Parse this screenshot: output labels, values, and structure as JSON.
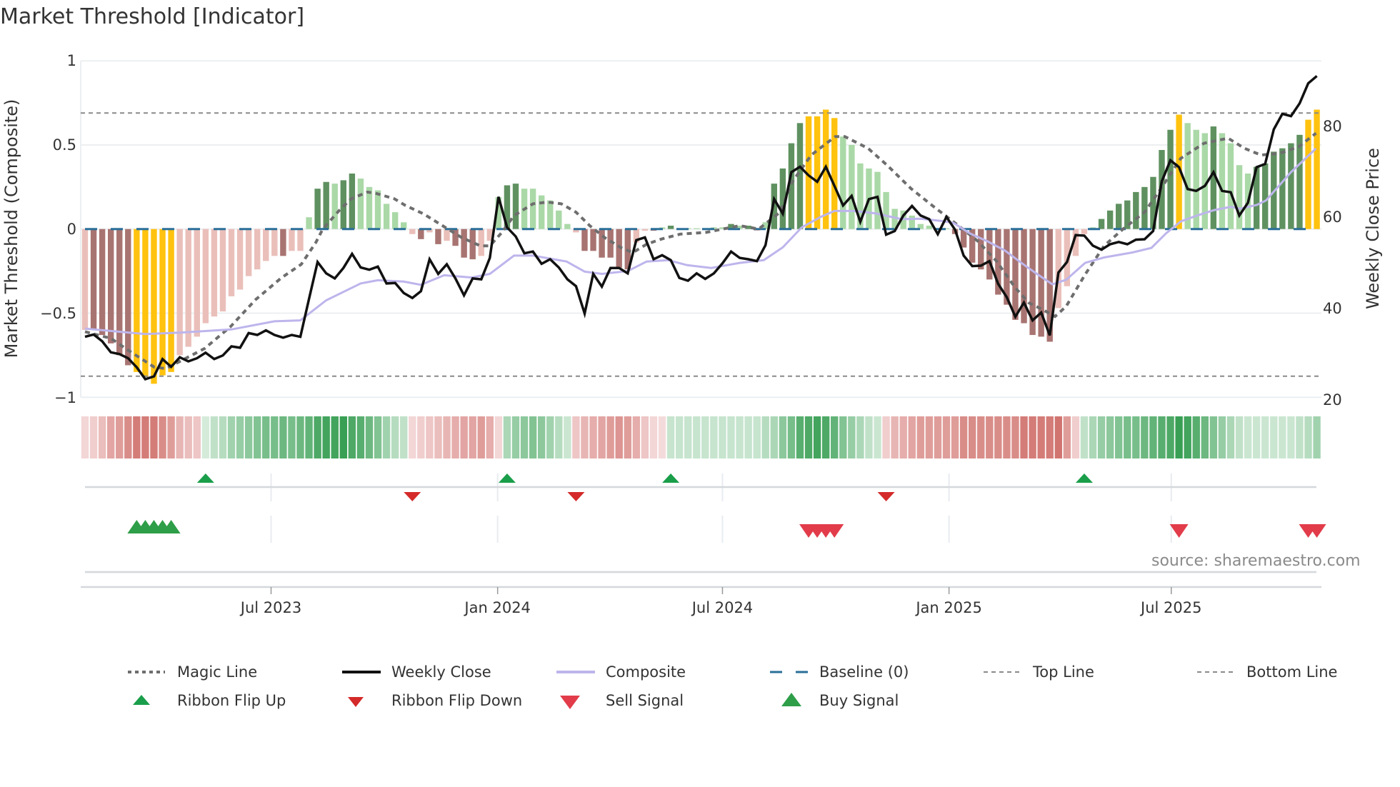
{
  "title": "Market Threshold [Indicator]",
  "source": "source: sharemaestro.com",
  "colors": {
    "bar_dark_red": "#a87471",
    "bar_light_red": "#eabfba",
    "bar_yellow": "#ffc20e",
    "bar_dark_green": "#5f9160",
    "bar_light_green": "#aad9a7",
    "weekly_close": "#111111",
    "composite": "#bdb5ec",
    "magic": "#6e6e6e",
    "baseline": "#2a6f99",
    "threshold": "#8a8a8a",
    "ribbon_green": "#2e9a4b",
    "ribbon_red": "#c85a55",
    "flip_up": "#1a9e4a",
    "flip_down": "#d42a2a",
    "buy": "#2e9e48",
    "sell": "#e23c4a"
  },
  "legend": {
    "magic": "Magic Line",
    "close": "Weekly Close",
    "composite": "Composite",
    "baseline": "Baseline (0)",
    "top": "Top Line",
    "bottom": "Bottom Line",
    "flip_up": "Ribbon Flip Up",
    "flip_down": "Ribbon Flip Down",
    "sell": "Sell Signal",
    "buy": "Buy Signal"
  },
  "chart_data": {
    "type": "bar+line",
    "title": "Market Threshold [Indicator]",
    "x_unit": "week index (weekly bars)",
    "n_weeks": 144,
    "x_ticks": [
      {
        "label": "Jul 2023",
        "week": 21.6
      },
      {
        "label": "Jan 2024",
        "week": 47.9
      },
      {
        "label": "Jul 2024",
        "week": 74.0
      },
      {
        "label": "Jan 2025",
        "week": 100.3
      },
      {
        "label": "Jul 2025",
        "week": 126.1
      }
    ],
    "y_left": {
      "label": "Market Threshold (Composite)",
      "range": [
        -1,
        1
      ],
      "ticks": [
        1,
        0.5,
        0,
        -0.5,
        -1
      ],
      "tick_labels": [
        "1",
        "0.5",
        "0",
        "−0.5",
        "−1"
      ]
    },
    "y_right": {
      "label": "Weekly Close Price",
      "range": [
        20,
        80
      ],
      "ticks": [
        80,
        60,
        40,
        20
      ],
      "tick_labels": [
        "80",
        "60",
        "40",
        "20"
      ]
    },
    "grid": true,
    "legend_placement": "bottom",
    "top_line": 0.69,
    "bottom_line": -0.875,
    "baseline": 0,
    "composite_bars": [
      -0.6,
      -0.6,
      -0.63,
      -0.68,
      -0.75,
      -0.81,
      -0.85,
      -0.88,
      -0.92,
      -0.87,
      -0.85,
      -0.75,
      -0.7,
      -0.64,
      -0.56,
      -0.52,
      -0.49,
      -0.4,
      -0.36,
      -0.28,
      -0.24,
      -0.19,
      -0.16,
      -0.16,
      -0.13,
      -0.13,
      0.07,
      0.24,
      0.28,
      0.27,
      0.29,
      0.33,
      0.3,
      0.25,
      0.23,
      0.15,
      0.1,
      0.04,
      -0.03,
      -0.06,
      -0.02,
      -0.09,
      -0.07,
      -0.1,
      -0.17,
      -0.18,
      -0.16,
      -0.07,
      0.19,
      0.26,
      0.27,
      0.24,
      0.24,
      0.2,
      0.17,
      0.11,
      0.03,
      -0.02,
      -0.13,
      -0.13,
      -0.17,
      -0.17,
      -0.23,
      -0.24,
      -0.08,
      -0.01,
      -0.01,
      0.01,
      0.02,
      0.005,
      0.005,
      0.005,
      0.005,
      0.01,
      0.01,
      0.03,
      0.02,
      0.02,
      -0.01,
      0.04,
      0.27,
      0.36,
      0.51,
      0.63,
      0.67,
      0.67,
      0.71,
      0.66,
      0.55,
      0.5,
      0.39,
      0.36,
      0.34,
      0.22,
      0.12,
      0.11,
      0.08,
      0.03,
      0.02,
      0.005,
      0.005,
      -0.03,
      -0.11,
      -0.2,
      -0.24,
      -0.3,
      -0.39,
      -0.45,
      -0.54,
      -0.56,
      -0.63,
      -0.64,
      -0.67,
      -0.47,
      -0.34,
      -0.16,
      -0.03,
      0.01,
      0.06,
      0.11,
      0.15,
      0.17,
      0.22,
      0.25,
      0.31,
      0.47,
      0.59,
      0.68,
      0.63,
      0.59,
      0.57,
      0.61,
      0.57,
      0.51,
      0.38,
      0.33,
      0.37,
      0.39,
      0.46,
      0.48,
      0.51,
      0.56,
      0.65,
      0.71
    ],
    "bar_color_codes": "LDDDDDYYYYYLLLLLLLLLLLLDLLgGGgGGggggggLDLDLDDDLLgGGggggggLDDDDDDLLDgGggggggGgGLgGGGGYYYYgggggggggggggDDDDDDDDDDDDLLLLgGGGGGGGGGYgggGggggGGGGGGYY",
    "bar_color_legend": {
      "D": "falling negative",
      "L": "rising negative",
      "Y": "signal",
      "G": "rising positive",
      "g": "falling positive"
    },
    "weekly_close": [
      33.7,
      34.2,
      32.7,
      30.3,
      29.9,
      29.0,
      27.0,
      24.4,
      25.0,
      28.8,
      27.1,
      29.2,
      28.3,
      29.0,
      30.2,
      28.8,
      29.6,
      31.6,
      31.3,
      34.5,
      34.1,
      35.1,
      34.1,
      33.5,
      34.1,
      33.7,
      42.0,
      50.1,
      47.6,
      46.5,
      48.8,
      51.9,
      48.9,
      48.4,
      49.1,
      45.4,
      45.5,
      43.3,
      42.2,
      43.7,
      50.7,
      47.5,
      49.6,
      46.5,
      42.8,
      46.5,
      46.3,
      51.0,
      64.4,
      57.7,
      55.7,
      52.0,
      52.4,
      49.7,
      50.7,
      48.9,
      46.3,
      44.8,
      38.8,
      47.5,
      44.7,
      48.8,
      48.8,
      47.6,
      54.9,
      55.5,
      50.7,
      51.6,
      50.5,
      46.6,
      46.0,
      47.6,
      46.4,
      47.6,
      49.8,
      52.4,
      51.0,
      50.7,
      50.3,
      53.8,
      63.9,
      60.7,
      69.8,
      71.0,
      69.1,
      67.7,
      71.0,
      66.8,
      62.5,
      64.6,
      58.9,
      63.9,
      64.4,
      56.1,
      56.9,
      60.3,
      62.4,
      60.3,
      59.5,
      56.2,
      60.0,
      57.2,
      51.5,
      49.2,
      49.3,
      50.3,
      45.3,
      42.4,
      38.1,
      41.2,
      37.3,
      39.0,
      34.0,
      47.8,
      50.1,
      56.0,
      55.9,
      53.7,
      52.8,
      54.0,
      54.5,
      54.0,
      55.0,
      55.1,
      56.9,
      67.8,
      72.4,
      70.9,
      66.1,
      65.7,
      66.8,
      69.8,
      65.7,
      65.4,
      60.3,
      63.1,
      70.9,
      71.6,
      79.2,
      82.6,
      82.1,
      84.9,
      89.3,
      90.9
    ],
    "composite_line_axis": "right",
    "composite_line": [
      [
        0,
        35.5
      ],
      [
        7,
        34.3
      ],
      [
        11,
        34.6
      ],
      [
        17,
        35.3
      ],
      [
        22,
        37.1
      ],
      [
        25,
        37.3
      ],
      [
        28,
        41.7
      ],
      [
        32,
        45.4
      ],
      [
        34,
        46.1
      ],
      [
        37,
        45.8
      ],
      [
        39,
        45.1
      ],
      [
        41.7,
        47.2
      ],
      [
        44.9,
        46.7
      ],
      [
        47,
        47.5
      ],
      [
        49.8,
        51.5
      ],
      [
        52,
        51.5
      ],
      [
        55.9,
        50.2
      ],
      [
        58,
        48.0
      ],
      [
        60,
        47.5
      ],
      [
        63,
        48.1
      ],
      [
        65.2,
        50.2
      ],
      [
        67.7,
        50.5
      ],
      [
        69.9,
        49.4
      ],
      [
        72.7,
        48.8
      ],
      [
        76,
        49.9
      ],
      [
        78.8,
        50.5
      ],
      [
        81,
        53.3
      ],
      [
        83.2,
        57.7
      ],
      [
        85.4,
        60.0
      ],
      [
        87,
        61.3
      ],
      [
        89.2,
        61.3
      ],
      [
        91.7,
        60.8
      ],
      [
        94.8,
        59.5
      ],
      [
        97,
        59.6
      ],
      [
        99.4,
        59.1
      ],
      [
        100.8,
        58.7
      ],
      [
        102.7,
        56.4
      ],
      [
        104.8,
        54.6
      ],
      [
        106.8,
        52.6
      ],
      [
        108.7,
        49.9
      ],
      [
        110.5,
        47.5
      ],
      [
        112.3,
        45.2
      ],
      [
        113.9,
        46.2
      ],
      [
        116.1,
        49.9
      ],
      [
        118.3,
        51.1
      ],
      [
        121.6,
        52.2
      ],
      [
        123.8,
        53.2
      ],
      [
        125.5,
        56.4
      ],
      [
        127.2,
        59.0
      ],
      [
        129.1,
        60.3
      ],
      [
        131.1,
        61.5
      ],
      [
        133,
        62.2
      ],
      [
        134.1,
        61.8
      ],
      [
        136,
        62.6
      ],
      [
        137.1,
        63.6
      ],
      [
        140,
        69.8
      ],
      [
        142.9,
        75.0
      ]
    ],
    "magic_line": [
      [
        0,
        -0.61
      ],
      [
        3,
        -0.65
      ],
      [
        5,
        -0.72
      ],
      [
        8,
        -0.82
      ],
      [
        9.4,
        -0.83
      ],
      [
        10.9,
        -0.79
      ],
      [
        13.9,
        -0.71
      ],
      [
        16.9,
        -0.58
      ],
      [
        19.8,
        -0.42
      ],
      [
        22.8,
        -0.29
      ],
      [
        25.1,
        -0.21
      ],
      [
        26.8,
        -0.08
      ],
      [
        27.6,
        0
      ],
      [
        29.5,
        0.11
      ],
      [
        30.9,
        0.18
      ],
      [
        32.8,
        0.22
      ],
      [
        33.9,
        0.21
      ],
      [
        35.9,
        0.18
      ],
      [
        37.2,
        0.14
      ],
      [
        39.3,
        0.09
      ],
      [
        41.5,
        0.02
      ],
      [
        43.7,
        -0.05
      ],
      [
        45.9,
        -0.1
      ],
      [
        47,
        -0.1
      ],
      [
        48.4,
        -0.02
      ],
      [
        49.8,
        0.08
      ],
      [
        52,
        0.15
      ],
      [
        53.7,
        0.16
      ],
      [
        55.3,
        0.15
      ],
      [
        57,
        0.1
      ],
      [
        58.6,
        0.02
      ],
      [
        60.3,
        -0.05
      ],
      [
        62.2,
        -0.11
      ],
      [
        63.6,
        -0.14
      ],
      [
        65.2,
        -0.09
      ],
      [
        66.9,
        -0.06
      ],
      [
        69.1,
        -0.03
      ],
      [
        72.1,
        -0.02
      ],
      [
        76,
        0.02
      ],
      [
        78.2,
        0
      ],
      [
        80.7,
        0.1
      ],
      [
        82.1,
        0.28
      ],
      [
        84.3,
        0.44
      ],
      [
        87.1,
        0.55
      ],
      [
        88.2,
        0.55
      ],
      [
        90.9,
        0.48
      ],
      [
        93.1,
        0.38
      ],
      [
        95.9,
        0.24
      ],
      [
        98.6,
        0.13
      ],
      [
        101.4,
        0.02
      ],
      [
        103.6,
        -0.07
      ],
      [
        105.8,
        -0.19
      ],
      [
        108,
        -0.35
      ],
      [
        109.6,
        -0.44
      ],
      [
        111.2,
        -0.48
      ],
      [
        112.6,
        -0.52
      ],
      [
        113.9,
        -0.46
      ],
      [
        116.1,
        -0.27
      ],
      [
        118.3,
        -0.1
      ],
      [
        120.5,
        0
      ],
      [
        123,
        0.1
      ],
      [
        124.9,
        0.24
      ],
      [
        127.2,
        0.42
      ],
      [
        129.9,
        0.51
      ],
      [
        132.7,
        0.54
      ],
      [
        134.6,
        0.48
      ],
      [
        136.5,
        0.44
      ],
      [
        138.7,
        0.45
      ],
      [
        140.9,
        0.49
      ],
      [
        142.9,
        0.57
      ]
    ],
    "ribbon": [
      -0.15,
      -0.2,
      -0.3,
      -0.45,
      -0.5,
      -0.6,
      -0.7,
      -0.7,
      -0.7,
      -0.6,
      -0.5,
      -0.35,
      -0.3,
      -0.25,
      0.15,
      0.25,
      0.3,
      0.4,
      0.45,
      0.5,
      0.55,
      0.6,
      0.6,
      0.65,
      0.6,
      0.65,
      0.7,
      0.8,
      0.85,
      0.85,
      0.9,
      0.8,
      0.75,
      0.65,
      0.55,
      0.4,
      0.3,
      0.25,
      -0.15,
      -0.2,
      -0.25,
      -0.3,
      -0.35,
      -0.4,
      -0.45,
      -0.45,
      -0.5,
      -0.4,
      -0.15,
      0.35,
      0.45,
      0.5,
      0.55,
      0.5,
      0.4,
      0.3,
      0.2,
      -0.25,
      -0.35,
      -0.4,
      -0.45,
      -0.5,
      -0.55,
      -0.5,
      -0.4,
      -0.25,
      -0.15,
      -0.12,
      0.22,
      0.22,
      0.22,
      0.22,
      0.22,
      0.22,
      0.22,
      0.22,
      0.22,
      0.22,
      0.22,
      0.3,
      0.35,
      0.5,
      0.6,
      0.75,
      0.8,
      0.85,
      0.8,
      0.7,
      0.55,
      0.45,
      0.35,
      0.25,
      0.2,
      -0.2,
      -0.35,
      -0.4,
      -0.45,
      -0.5,
      -0.5,
      -0.5,
      -0.5,
      -0.5,
      -0.6,
      -0.6,
      -0.6,
      -0.6,
      -0.6,
      -0.6,
      -0.6,
      -0.7,
      -0.7,
      -0.7,
      -0.7,
      -0.75,
      -0.5,
      -0.2,
      0.25,
      0.35,
      0.45,
      0.5,
      0.55,
      0.6,
      0.6,
      0.65,
      0.7,
      0.75,
      0.8,
      0.9,
      0.85,
      0.75,
      0.65,
      0.55,
      0.45,
      0.35,
      0.25,
      0.2,
      0.2,
      0.2,
      0.2,
      0.2,
      0.2,
      0.25,
      0.3,
      0.4
    ],
    "ribbon_flip_up": [
      14,
      49,
      68,
      116
    ],
    "ribbon_flip_down": [
      38,
      57,
      93
    ],
    "buy_signals": [
      6,
      7,
      8,
      9,
      10
    ],
    "sell_signals": [
      84,
      85,
      86,
      87,
      127,
      142,
      143
    ]
  }
}
